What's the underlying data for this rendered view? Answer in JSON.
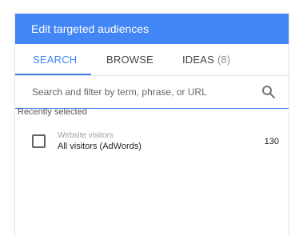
{
  "header": {
    "title": "Edit targeted audiences"
  },
  "tabs": [
    {
      "label": "SEARCH",
      "count": ""
    },
    {
      "label": "BROWSE",
      "count": ""
    },
    {
      "label": "IDEAS",
      "count": "(8)"
    }
  ],
  "search": {
    "placeholder": "Search and filter by term, phrase, or URL",
    "value": ""
  },
  "recent": {
    "label": "Recently selected",
    "items": [
      {
        "category": "Website visitors",
        "name": "All visitors (AdWords)",
        "count": "130",
        "checked": false
      }
    ]
  },
  "colors": {
    "accent": "#4285f4",
    "header_text": "#ffffff"
  },
  "icons": {
    "search": "search-icon"
  }
}
